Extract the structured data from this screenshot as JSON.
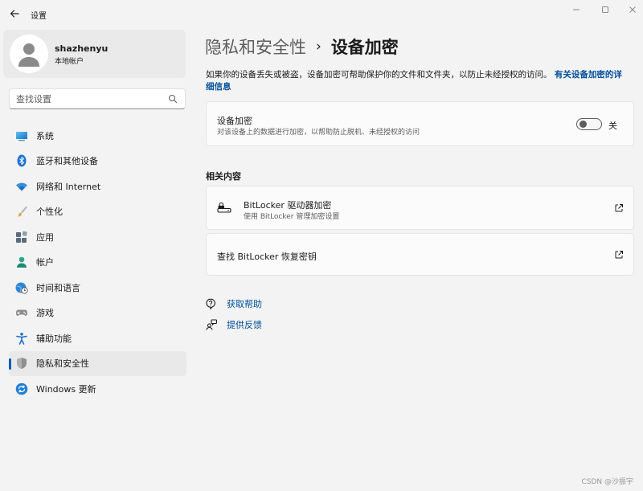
{
  "window": {
    "title": "设置"
  },
  "profile": {
    "name": "shazhenyu",
    "account_type": "本地帐户"
  },
  "search": {
    "placeholder": "查找设置"
  },
  "sidebar": {
    "items": [
      {
        "label": "系统",
        "icon": "system-icon"
      },
      {
        "label": "蓝牙和其他设备",
        "icon": "bluetooth-icon"
      },
      {
        "label": "网络和 Internet",
        "icon": "wifi-icon"
      },
      {
        "label": "个性化",
        "icon": "brush-icon"
      },
      {
        "label": "应用",
        "icon": "apps-icon"
      },
      {
        "label": "帐户",
        "icon": "person-icon"
      },
      {
        "label": "时间和语言",
        "icon": "globe-clock-icon"
      },
      {
        "label": "游戏",
        "icon": "gamepad-icon"
      },
      {
        "label": "辅助功能",
        "icon": "accessibility-icon"
      },
      {
        "label": "隐私和安全性",
        "icon": "shield-icon"
      },
      {
        "label": "Windows 更新",
        "icon": "update-icon"
      }
    ],
    "active_index": 9
  },
  "breadcrumb": {
    "parent": "隐私和安全性",
    "separator": "›",
    "current": "设备加密"
  },
  "description": {
    "text": "如果你的设备丢失或被盗，设备加密可帮助保护你的文件和文件夹，以防止未经授权的访问。",
    "link": "有关设备加密的详细信息"
  },
  "encryption_card": {
    "title": "设备加密",
    "subtitle": "对该设备上的数据进行加密，以帮助防止脱机、未经授权的访问",
    "toggle_state": "关",
    "toggle_on": false
  },
  "related": {
    "heading": "相关内容",
    "bitlocker": {
      "title": "BitLocker 驱动器加密",
      "subtitle": "使用 BitLocker 管理加密设置"
    },
    "recovery_key": {
      "title": "查找 BitLocker 恢复密钥"
    }
  },
  "help": {
    "get_help": "获取帮助",
    "feedback": "提供反馈"
  },
  "watermark": "CSDN @沙振宇",
  "colors": {
    "accent": "#005fb8",
    "link": "#004e9c",
    "background": "#f3f3f3",
    "card": "#fbfbfb"
  }
}
